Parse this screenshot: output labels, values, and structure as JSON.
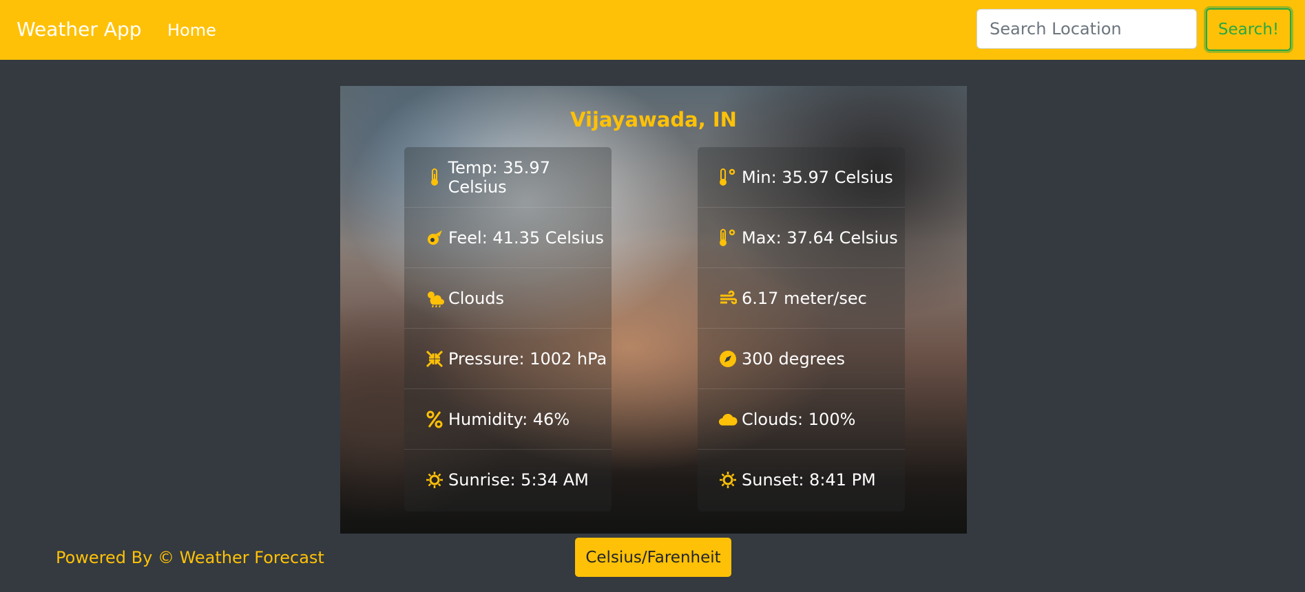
{
  "navbar": {
    "brand": "Weather App",
    "home": "Home",
    "search_placeholder": "Search Location",
    "search_button": "Search!",
    "bg_color": "#ffc107"
  },
  "weather": {
    "location": "Vijayawada, IN",
    "left": [
      {
        "icon": "thermometer-icon",
        "text": "Temp: 35.97 Celsius"
      },
      {
        "icon": "meteor-icon",
        "text": "Feel: 41.35 Celsius"
      },
      {
        "icon": "cloud-sun-rain-icon",
        "text": "Clouds"
      },
      {
        "icon": "compress-arrows-icon",
        "text": "Pressure: 1002 hPa"
      },
      {
        "icon": "percent-icon",
        "text": "Humidity: 46%"
      },
      {
        "icon": "sun-icon",
        "text": "Sunrise: 5:34 AM"
      }
    ],
    "right": [
      {
        "icon": "temperature-low-icon",
        "text": "Min: 35.97 Celsius"
      },
      {
        "icon": "temperature-high-icon",
        "text": "Max: 37.64 Celsius"
      },
      {
        "icon": "wind-icon",
        "text": "6.17 meter/sec"
      },
      {
        "icon": "compass-icon",
        "text": "300 degrees"
      },
      {
        "icon": "cloud-icon",
        "text": "Clouds: 100%"
      },
      {
        "icon": "sun-icon",
        "text": "Sunset: 8:41 PM"
      }
    ]
  },
  "footer": {
    "powered_by": "Powered By © Weather Forecast",
    "unit_toggle": "Celsius/Farenheit"
  },
  "colors": {
    "accent": "#ffc107",
    "background": "#343a40",
    "success": "#28a745"
  }
}
